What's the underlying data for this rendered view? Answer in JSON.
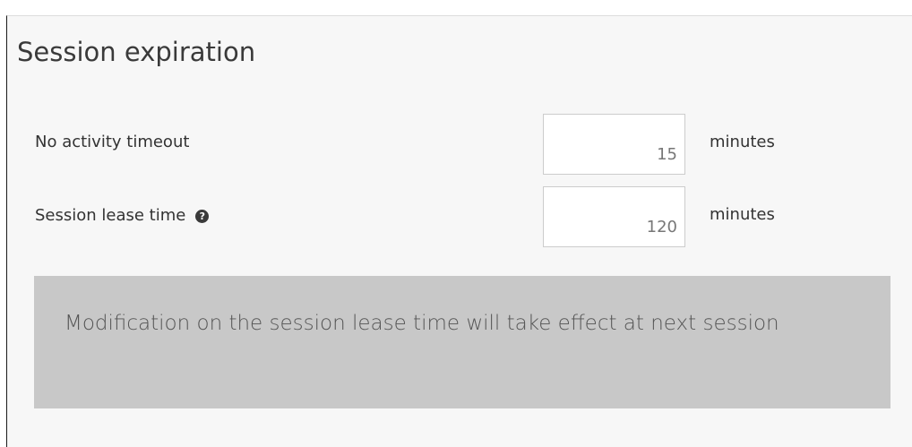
{
  "section": {
    "title": "Session expiration"
  },
  "fields": {
    "no_activity_timeout": {
      "label": "No activity timeout",
      "value": "15",
      "unit": "minutes"
    },
    "session_lease_time": {
      "label": "Session lease time",
      "value": "120",
      "unit": "minutes",
      "help_icon": "help-circle-icon",
      "help_glyph": "?"
    }
  },
  "notice": {
    "text": "Modification on the session lease time will take effect at next session"
  },
  "colors": {
    "panel_background": "#f7f7f7",
    "notice_background": "#c8c8c8",
    "text": "#333333"
  }
}
